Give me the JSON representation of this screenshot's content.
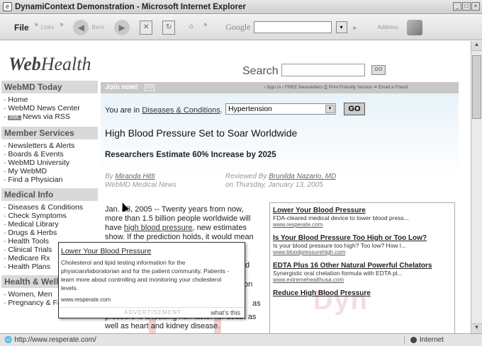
{
  "window": {
    "title": "DynamiContext Demonstration - Microsoft Internet Explorer",
    "buttons": [
      "_",
      "□",
      "×"
    ]
  },
  "toolbar": {
    "file_label": "File",
    "links_label": "Links",
    "back_label": "Back",
    "google_label": "Google",
    "search_dropdown": "▾",
    "address_label": "Address"
  },
  "site": {
    "logo_left": "Web",
    "logo_right": "Health",
    "search_label": "Search",
    "search_value": "",
    "search_go": "GO"
  },
  "sidebar": {
    "sections": [
      {
        "title": "WebMD Today",
        "items": [
          "Home",
          "WebMD News Center",
          "News via RSS"
        ]
      },
      {
        "title": "Member Services",
        "items": [
          "Newsletters & Alerts",
          "Boards & Events",
          "WebMD University",
          "My WebMD",
          "Find a Physician"
        ]
      },
      {
        "title": "Medical Info",
        "items": [
          "Diseases & Conditions",
          "Check Symptoms",
          "Medical Library",
          "Drugs & Herbs",
          "Health Tools",
          "Clinical Trials",
          "Medicare Rx",
          "Health Plans"
        ]
      },
      {
        "title": "Health & Wellness",
        "items": [
          "Women, Men",
          "Pregnancy & Family"
        ]
      }
    ],
    "xml_badge": "XML"
  },
  "topbar": {
    "join_label": "Join now!",
    "join_go": "GO",
    "links": "› Sign In  › FREE Newsletters  ⎙ Print Friendly Version  ✉ Email a Friend"
  },
  "breadcrumb": {
    "prefix": "You are in",
    "link": "Diseases & Conditions",
    "suffix": "."
  },
  "topic_select": {
    "value": "Hypertension",
    "go_label": "GO"
  },
  "article": {
    "headline": "High Blood Pressure Set to Soar Worldwide",
    "subhead": "Researchers Estimate 60% Increase by 2025",
    "by_prefix": "By",
    "author": "Miranda Hitti",
    "author_org": "WebMD Medical News",
    "reviewed_prefix": "Reviewed By",
    "reviewer": "Brunilda Nazario, MD",
    "reviewed_date": "on Thursday, January 13, 2005",
    "body_line1": "Jan. 13, 2005 -- Twenty years from now,",
    "body_line2": "more than 1.5 billion people worldwide will",
    "body_line3_pre": "have",
    "body_line3_link": "high blood pressure",
    "body_line3_post": ", new estimates",
    "body_line4": "show. If the prediction holds, it would mean",
    "body_d": "d",
    "body_on": "on",
    "body_as": "as",
    "body_bottom1": "pressure is a leading risk factor for death as",
    "body_bottom2": "well as heart and kidney disease."
  },
  "ads": [
    {
      "title": "Lower Your Blood Pressure",
      "desc": "FDA-cleared medical device to lower blood press...",
      "url": "www.resperate.com"
    },
    {
      "title": "Is Your Blood Pressure Too High or Too Low?",
      "desc": "Is your blood pressure too high? Too low? How l...",
      "url": "www.bloodpressurehigh.com"
    },
    {
      "title": "EDTA Plus 16 Other Natural Powerful Chelators",
      "desc": "Synergistic oral chelation formula with EDTA pl...",
      "url": "www.extremehealthusa.com"
    },
    {
      "title": "Reduce High Blood Pressure",
      "desc": "",
      "url": ""
    }
  ],
  "popup": {
    "title": "Lower Your Blood Pressure",
    "desc": "Cholesterol and lipid testing information for the physician/laboratorian and for the patient community. Patients - learn more about controlling and monitoring your cholesterol levels.",
    "url": "www.resperate.com",
    "advertisement": "ADVERTISEMENT",
    "whats_this": "what's this"
  },
  "watermark": "Dyn",
  "status": {
    "url": "http://www.resperate.com/",
    "zone": "Internet"
  }
}
